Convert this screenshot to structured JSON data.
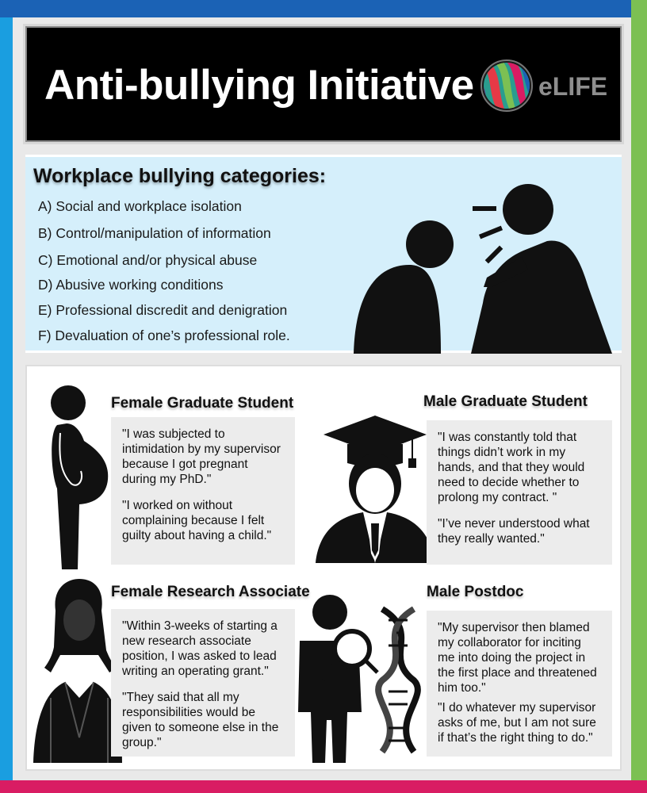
{
  "header": {
    "title": "Anti-bullying Initiative",
    "logo_text": "eLIFE",
    "logo_icon": "elife-logo-icon"
  },
  "categories": {
    "heading": "Workplace bullying categories:",
    "items": [
      "A) Social and workplace isolation",
      "B) Control/manipulation of information",
      "C) Emotional and/or physical abuse",
      "D) Abusive working conditions",
      "E) Professional discredit and denigration",
      "F) Devaluation of one’s professional role."
    ],
    "illustration": "shouting-figure-icon"
  },
  "personas": [
    {
      "title": "Female Graduate Student",
      "icon": "pregnant-woman-icon",
      "quotes": [
        "\"I was subjected to intimidation by my supervisor because I got pregnant during my PhD.\"",
        "\"I worked on without complaining because I felt guilty about having a child.\""
      ]
    },
    {
      "title": "Male Graduate Student",
      "icon": "graduate-student-icon",
      "quotes": [
        "\"I was constantly told that things didn’t work in my hands, and that they would need to decide whether to prolong my contract. \"",
        "\"I’ve never understood what they really wanted.\""
      ]
    },
    {
      "title": "Female Research Associate",
      "icon": "female-researcher-icon",
      "quotes": [
        "\"Within 3-weeks of starting a new research associate position, I was asked to lead writing an operating grant.\"",
        "\"They said that all my responsibilities would be given to someone else in the group.\""
      ]
    },
    {
      "title": "Male Postdoc",
      "icon": "researcher-magnifier-dna-icon",
      "quotes": [
        "\"My supervisor then blamed my collaborator for inciting me into doing the project in the first place and threatened him too.\"",
        "\"I do whatever my supervisor asks of me, but I am not sure if that’s the right thing to do.\""
      ]
    }
  ],
  "colors": {
    "top_bar": "#1b62b5",
    "left_bar": "#1a9ee0",
    "right_bar": "#7cc053",
    "bottom_bar": "#d91c63",
    "banner": "#000000",
    "categories_panel": "#d5effb",
    "quote_box": "#ececec"
  }
}
